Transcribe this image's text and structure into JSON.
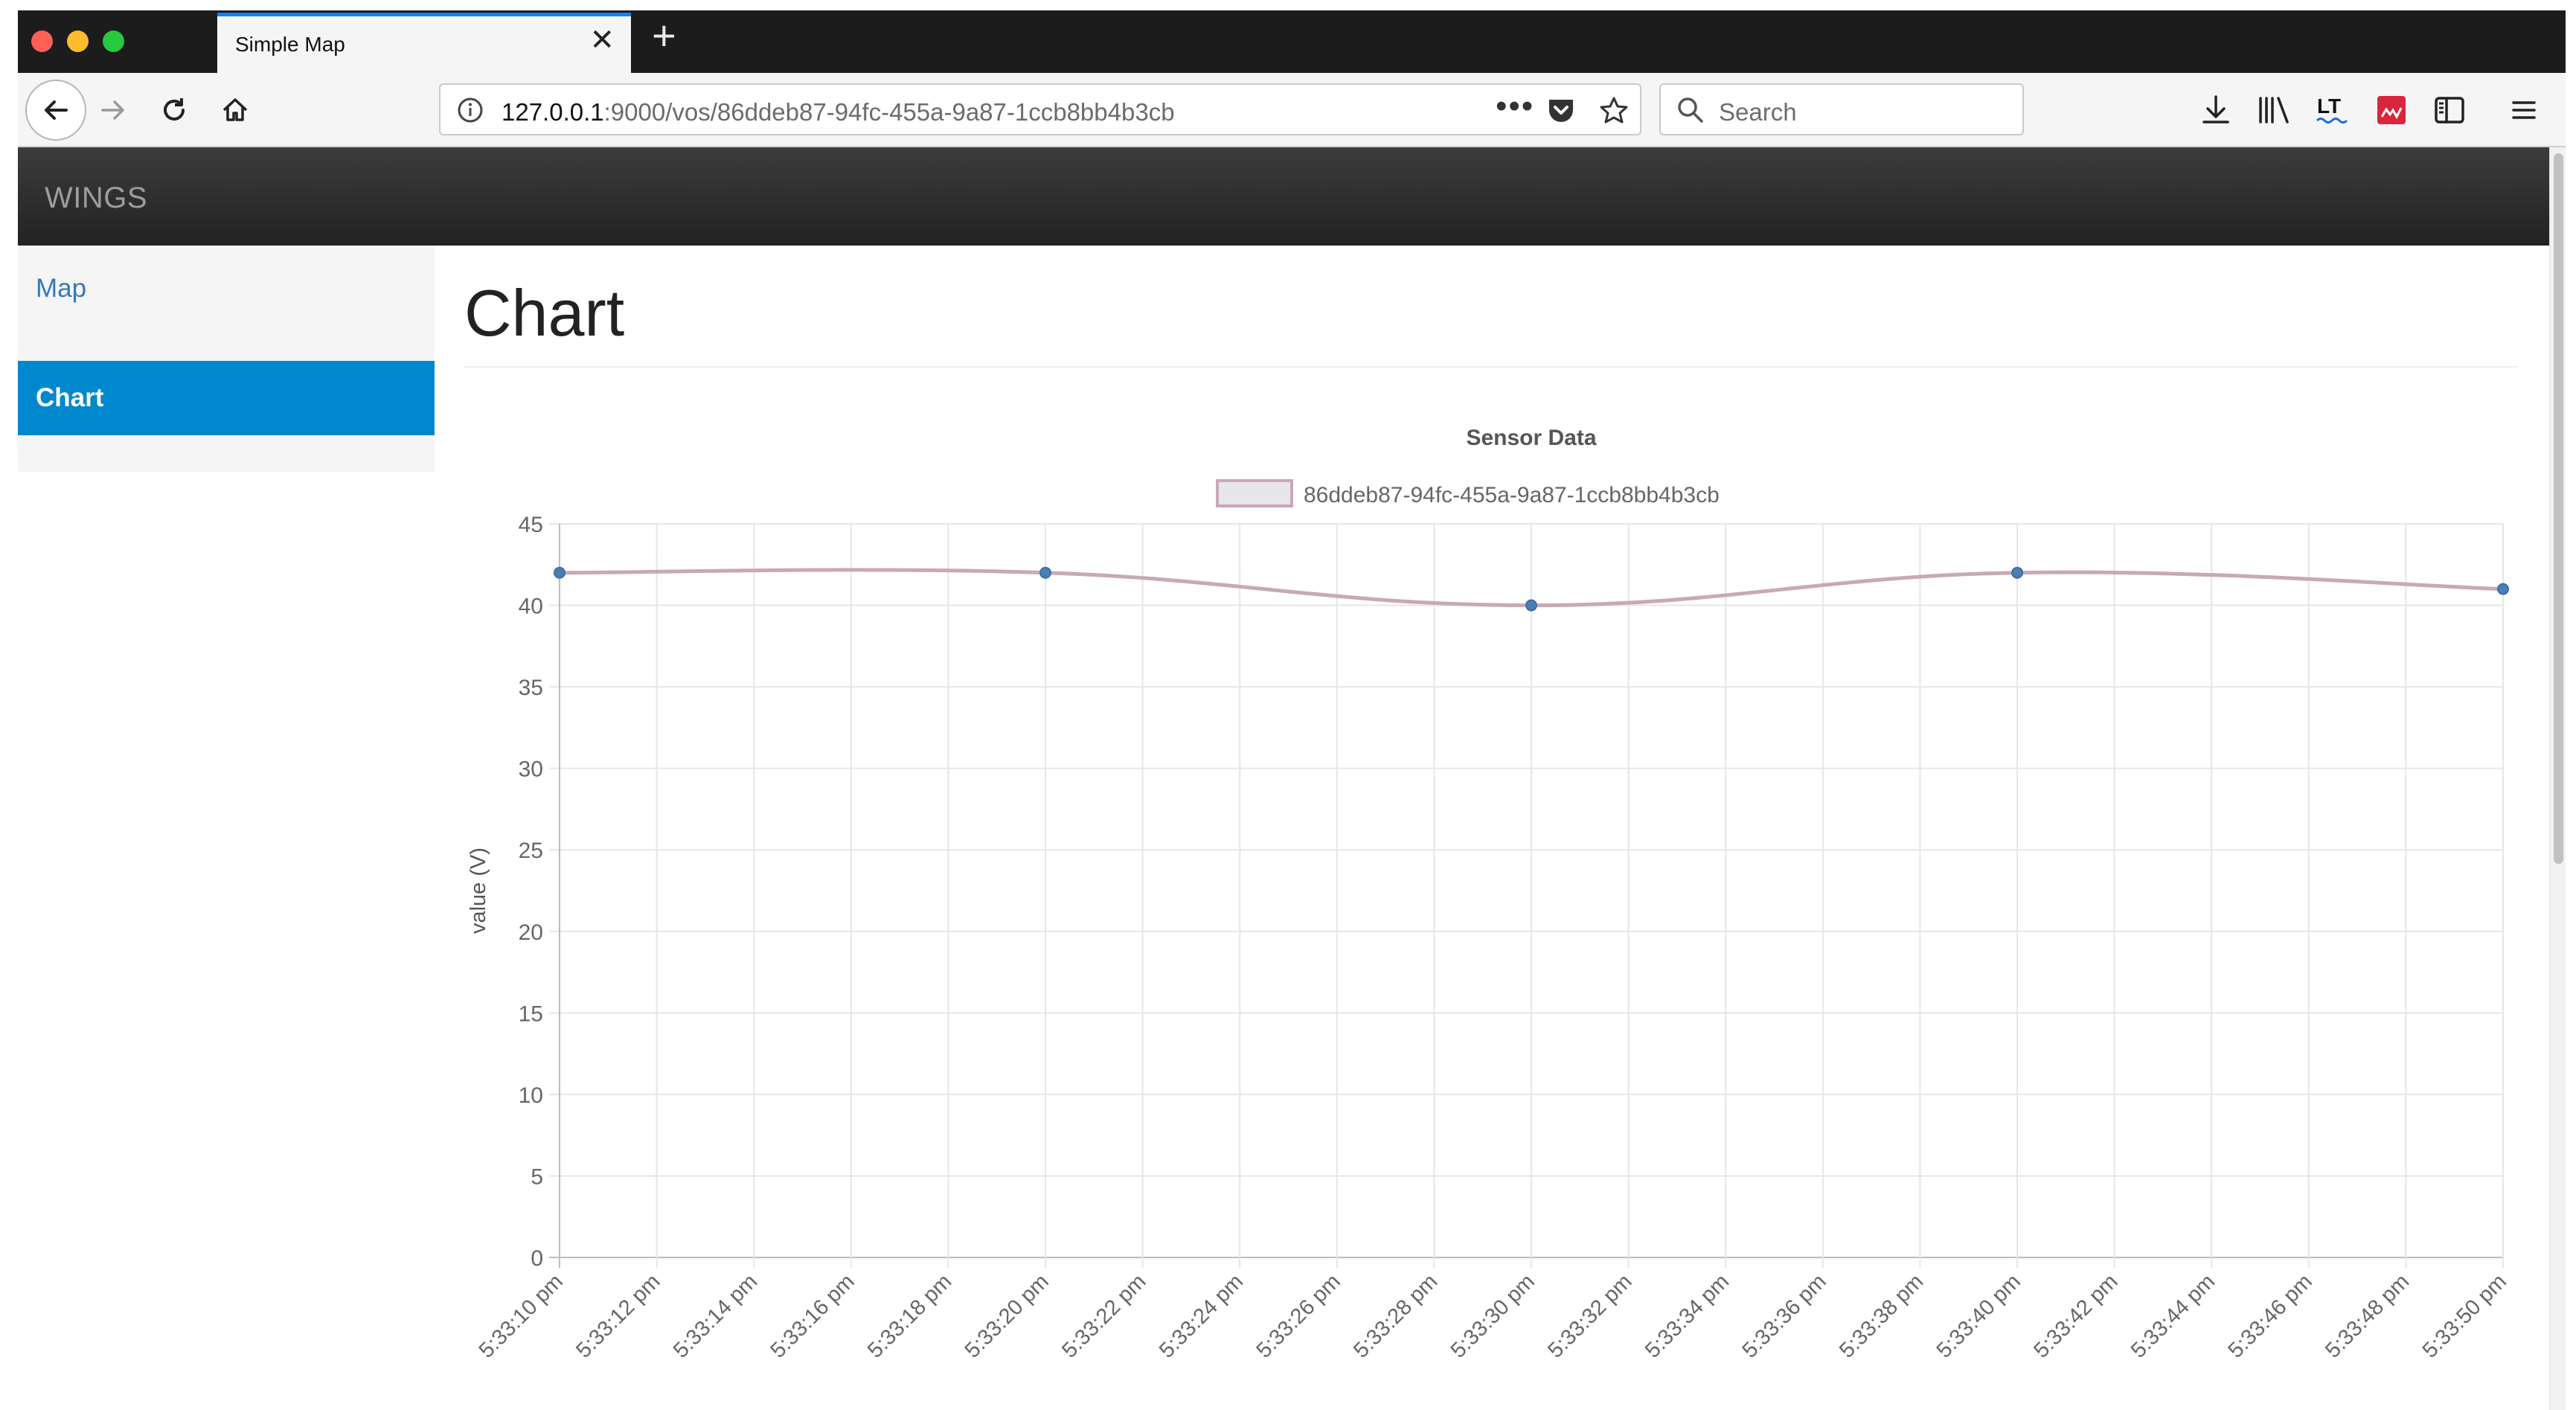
{
  "browser": {
    "tab_title": "Simple Map",
    "url_host": "127.0.0.1",
    "url_path": ":9000/vos/86ddeb87-94fc-455a-9a87-1ccb8bb4b3cb",
    "search_placeholder": "Search",
    "toolbar_icons": [
      "back-icon",
      "forward-icon",
      "reload-icon",
      "home-icon",
      "info-icon",
      "more-icon",
      "pocket-icon",
      "bookmark-star-icon",
      "search-icon",
      "download-icon",
      "library-icon",
      "lt-extension-icon",
      "red-extension-icon",
      "sidebar-icon",
      "menu-icon"
    ]
  },
  "app": {
    "brand": "WINGS",
    "sidebar": [
      {
        "label": "Map",
        "active": false
      },
      {
        "label": "Chart",
        "active": true
      }
    ],
    "page_title": "Chart"
  },
  "colors": {
    "accent": "#0088cc",
    "link": "#337ab7",
    "line": "#c9a8b8",
    "point": "#4a7fb5"
  },
  "chart_data": {
    "type": "line",
    "title": "Sensor Data",
    "xlabel": "",
    "ylabel": "value (V)",
    "ylim": [
      0,
      45
    ],
    "yticks": [
      0,
      5,
      10,
      15,
      20,
      25,
      30,
      35,
      40,
      45
    ],
    "grid": true,
    "legend_position": "top",
    "categories": [
      "5:33:10 pm",
      "5:33:12 pm",
      "5:33:14 pm",
      "5:33:16 pm",
      "5:33:18 pm",
      "5:33:20 pm",
      "5:33:22 pm",
      "5:33:24 pm",
      "5:33:26 pm",
      "5:33:28 pm",
      "5:33:30 pm",
      "5:33:32 pm",
      "5:33:34 pm",
      "5:33:36 pm",
      "5:33:38 pm",
      "5:33:40 pm",
      "5:33:42 pm",
      "5:33:44 pm",
      "5:33:46 pm",
      "5:33:48 pm",
      "5:33:50 pm"
    ],
    "series": [
      {
        "name": "86ddeb87-94fc-455a-9a87-1ccb8bb4b3cb",
        "points": [
          {
            "x": "5:33:10 pm",
            "y": 42
          },
          {
            "x": "5:33:20 pm",
            "y": 42
          },
          {
            "x": "5:33:30 pm",
            "y": 40
          },
          {
            "x": "5:33:40 pm",
            "y": 42
          },
          {
            "x": "5:33:50 pm",
            "y": 41
          }
        ]
      }
    ]
  }
}
